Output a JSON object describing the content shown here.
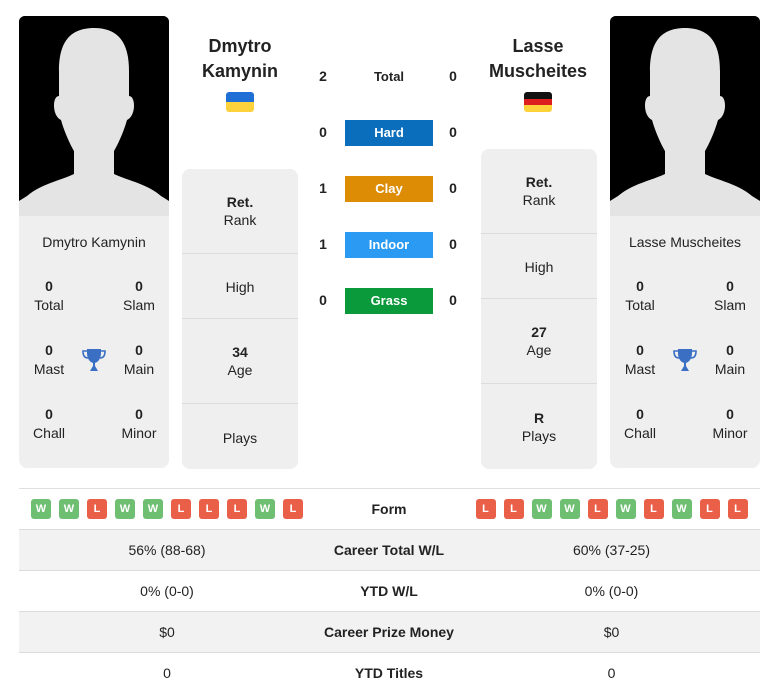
{
  "left_player": {
    "name_line1": "Dmytro",
    "name_line2": "Kamynin",
    "full_name": "Dmytro Kamynin",
    "country": "Ukraine",
    "flag_colors": [
      "#1f6fd6",
      "#fdd23a"
    ],
    "titles": {
      "total": {
        "value": "0",
        "label": "Total"
      },
      "slam": {
        "value": "0",
        "label": "Slam"
      },
      "mast": {
        "value": "0",
        "label": "Mast"
      },
      "main": {
        "value": "0",
        "label": "Main"
      },
      "chall": {
        "value": "0",
        "label": "Chall"
      },
      "minor": {
        "value": "0",
        "label": "Minor"
      }
    },
    "info": {
      "rank": {
        "value": "Ret.",
        "label": "Rank"
      },
      "high": {
        "value": "",
        "label": "High"
      },
      "age": {
        "value": "34",
        "label": "Age"
      },
      "plays": {
        "value": "",
        "label": "Plays"
      }
    },
    "form": [
      "W",
      "W",
      "L",
      "W",
      "W",
      "L",
      "L",
      "L",
      "W",
      "L"
    ],
    "career_total_wl": "56% (88-68)",
    "ytd_wl": "0% (0-0)",
    "career_prize_money": "$0",
    "ytd_titles": "0"
  },
  "right_player": {
    "name_line1": "Lasse",
    "name_line2": "Muscheites",
    "full_name": "Lasse Muscheites",
    "country": "Germany",
    "flag_colors": [
      "#111111",
      "#dd1f1f",
      "#fdd23a"
    ],
    "titles": {
      "total": {
        "value": "0",
        "label": "Total"
      },
      "slam": {
        "value": "0",
        "label": "Slam"
      },
      "mast": {
        "value": "0",
        "label": "Mast"
      },
      "main": {
        "value": "0",
        "label": "Main"
      },
      "chall": {
        "value": "0",
        "label": "Chall"
      },
      "minor": {
        "value": "0",
        "label": "Minor"
      }
    },
    "info": {
      "rank": {
        "value": "Ret.",
        "label": "Rank"
      },
      "high": {
        "value": "",
        "label": "High"
      },
      "age": {
        "value": "27",
        "label": "Age"
      },
      "plays": {
        "value": "R",
        "label": "Plays"
      }
    },
    "form": [
      "L",
      "L",
      "W",
      "W",
      "L",
      "W",
      "L",
      "W",
      "L",
      "L"
    ],
    "career_total_wl": "60% (37-25)",
    "ytd_wl": "0% (0-0)",
    "career_prize_money": "$0",
    "ytd_titles": "0"
  },
  "h2h": {
    "total": {
      "label": "Total",
      "left": "2",
      "right": "0"
    },
    "surfaces": [
      {
        "label": "Hard",
        "left": "0",
        "right": "0",
        "color": "#0a6ebd"
      },
      {
        "label": "Clay",
        "left": "1",
        "right": "0",
        "color": "#dd8c06"
      },
      {
        "label": "Indoor",
        "left": "1",
        "right": "0",
        "color": "#2b9af3"
      },
      {
        "label": "Grass",
        "left": "0",
        "right": "0",
        "color": "#0a9a3c"
      }
    ]
  },
  "table_labels": {
    "form": "Form",
    "career_total_wl": "Career Total W/L",
    "ytd_wl": "YTD W/L",
    "career_prize_money": "Career Prize Money",
    "ytd_titles": "YTD Titles"
  },
  "icons": {
    "trophy": "trophy-icon",
    "avatar": "player-silhouette"
  }
}
